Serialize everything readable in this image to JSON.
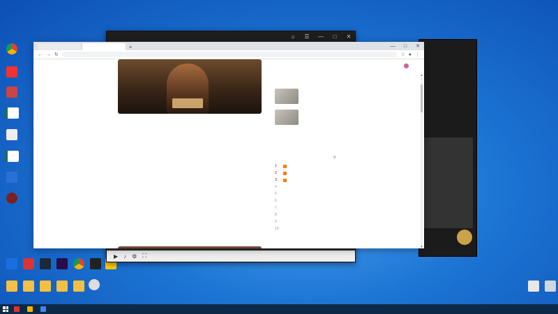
{
  "overlay": {
    "line1": "",
    "line2": "",
    "line3": "",
    "line4": "",
    "bottom_banner": ""
  },
  "desktop_icons": [
    {
      "label": ""
    },
    {
      "label": ""
    },
    {
      "label": ""
    },
    {
      "label": ""
    },
    {
      "label": ""
    },
    {
      "label": ""
    },
    {
      "label": ""
    },
    {
      "label": ""
    }
  ],
  "dock_icons": [
    {
      "label": ""
    },
    {
      "label": ""
    },
    {
      "label": ""
    },
    {
      "label": ""
    },
    {
      "label": ""
    },
    {
      "label": ""
    },
    {
      "label": ""
    },
    {
      "label": ""
    }
  ],
  "dark_window": {
    "title": ""
  },
  "right_panel": {
    "line1": "",
    "line2": "",
    "line3": "",
    "line4": "",
    "line5": "",
    "line6": ""
  },
  "browser": {
    "tabs": [
      {
        "label": ""
      },
      {
        "label": ""
      }
    ],
    "url": ""
  },
  "page": {
    "logo_a": "",
    "logo_b": "",
    "header_link": "",
    "user_name": "",
    "paragraphs": [
      "",
      ""
    ],
    "subhead": "",
    "paragraph3": ""
  },
  "sidebar": {
    "cards": [
      {
        "text": ""
      },
      {
        "text": ""
      }
    ],
    "hot_title": "",
    "hot_refresh": "",
    "hot_items": [
      {
        "num": "1",
        "text": ""
      },
      {
        "num": "2",
        "text": ""
      },
      {
        "num": "3",
        "text": ""
      },
      {
        "num": "4",
        "text": ""
      },
      {
        "num": "5",
        "text": ""
      },
      {
        "num": "6",
        "text": ""
      },
      {
        "num": "7",
        "text": ""
      },
      {
        "num": "8",
        "text": ""
      },
      {
        "num": "9",
        "text": ""
      },
      {
        "num": "10",
        "text": ""
      }
    ]
  },
  "taskbar": {
    "items": [
      {
        "label": ""
      },
      {
        "label": ""
      },
      {
        "label": ""
      }
    ],
    "time": "",
    "date": ""
  }
}
